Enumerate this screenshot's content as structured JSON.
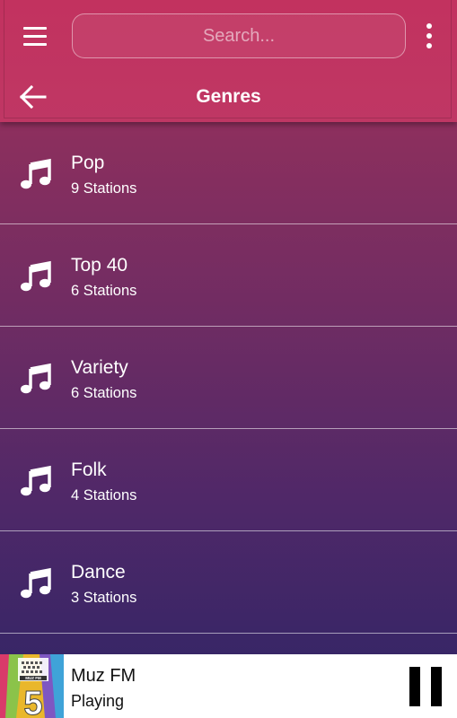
{
  "header": {
    "search_placeholder": "Search...",
    "title": "Genres",
    "menu_icon": "hamburger-menu-icon",
    "more_icon": "more-vertical-icon",
    "back_icon": "arrow-back-icon"
  },
  "genres": [
    {
      "name": "Pop",
      "count": "9 Stations",
      "icon": "music-note-icon"
    },
    {
      "name": "Top 40",
      "count": "6 Stations",
      "icon": "music-note-icon"
    },
    {
      "name": "Variety",
      "count": "6 Stations",
      "icon": "music-note-icon"
    },
    {
      "name": "Folk",
      "count": "4 Stations",
      "icon": "music-note-icon"
    },
    {
      "name": "Dance",
      "count": "3 Stations",
      "icon": "music-note-icon"
    }
  ],
  "player": {
    "station_name": "Muz FM",
    "status": "Playing",
    "logo_text": "5",
    "logo_label": "MUZ FM",
    "control_icon": "pause-icon"
  },
  "colors": {
    "header": "#c2325f",
    "gradient_top": "#a3335d",
    "gradient_bottom": "#2f2566",
    "text": "#ffffff",
    "player_bg": "#ffffff"
  }
}
